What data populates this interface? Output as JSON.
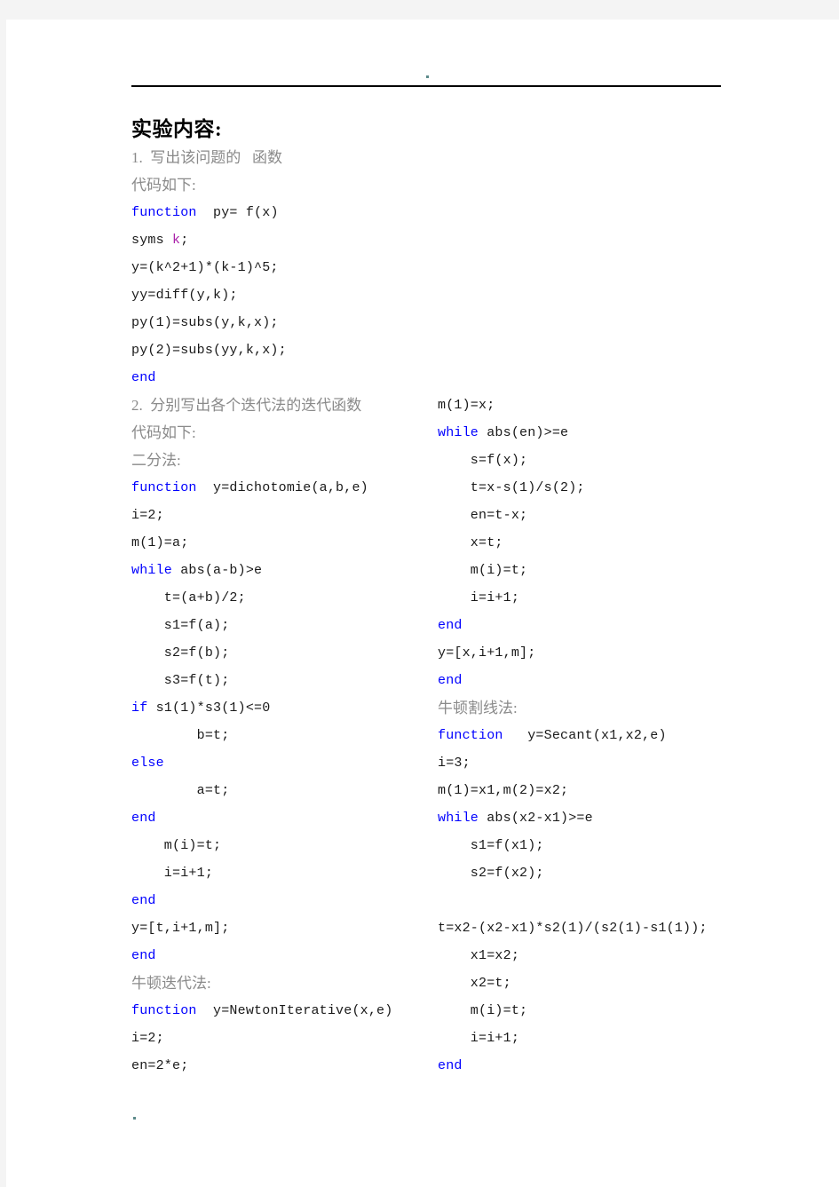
{
  "header": {
    "dot": "header-dot-mark",
    "rule": "horizontal-rule"
  },
  "title": "实验内容:",
  "intro": {
    "item1": "1.  写出该问题的   函数",
    "code_label_1": "代码如下:"
  },
  "section1_code": [
    {
      "t": "function  py= f(x)",
      "kw": "function"
    },
    {
      "t": "syms k;",
      "kw": "",
      "var": "k"
    },
    {
      "t": "y=(k^2+1)*(k-1)^5;"
    },
    {
      "t": "yy=diff(y,k);"
    },
    {
      "t": "py(1)=subs(y,k,x);"
    },
    {
      "t": "py(2)=subs(yy,k,x);"
    },
    {
      "t": "end",
      "kw": "end"
    }
  ],
  "intro2": {
    "item2": "2.  分别写出各个迭代法的迭代函数",
    "code_label_2": "代码如下:"
  },
  "left_column": {
    "method1_label": "二分法:",
    "method1_code": [
      "function  y=dichotomie(a,b,e)",
      "i=2;",
      "m(1)=a;",
      "while abs(a-b)>e",
      "    t=(a+b)/2;",
      "    s1=f(a);",
      "    s2=f(b);",
      "    s3=f(t);",
      "if s1(1)*s3(1)<=0",
      "        b=t;",
      "else",
      "        a=t;",
      "end",
      "    m(i)=t;",
      "    i=i+1;",
      "end",
      "y=[t,i+1,m];",
      "end"
    ],
    "method2_label": "牛顿迭代法:",
    "method2_code": [
      "function  y=NewtonIterative(x,e)",
      "i=2;",
      "en=2*e;"
    ]
  },
  "right_column": {
    "continued_code": [
      "m(1)=x;",
      "while abs(en)>=e",
      "    s=f(x);",
      "    t=x-s(1)/s(2);",
      "    en=t-x;",
      "    x=t;",
      "    m(i)=t;",
      "    i=i+1;",
      "end",
      "y=[x,i+1,m];",
      "end"
    ],
    "method3_label": "牛顿割线法:",
    "method3_code": [
      "function   y=Secant(x1,x2,e)",
      "i=3;",
      "m(1)=x1,m(2)=x2;",
      "while abs(x2-x1)>=e",
      "    s1=f(x1);",
      "    s2=f(x2);",
      "",
      "t=x2-(x2-x1)*s2(1)/(s2(1)-s1(1));",
      "    x1=x2;",
      "    x2=t;",
      "    m(i)=t;",
      "    i=i+1;",
      "end"
    ]
  },
  "keywords": [
    "function",
    "end",
    "while",
    "if",
    "else",
    "syms"
  ],
  "colors": {
    "keyword": "#0000ff",
    "variable": "#aa22aa",
    "body_text": "#8a8a8a",
    "code_text": "#1a1a1a",
    "title": "#000000",
    "page": "#ffffff",
    "margin": "#f4f4f4"
  },
  "footer": {
    "dot": "footer-dot-mark"
  }
}
